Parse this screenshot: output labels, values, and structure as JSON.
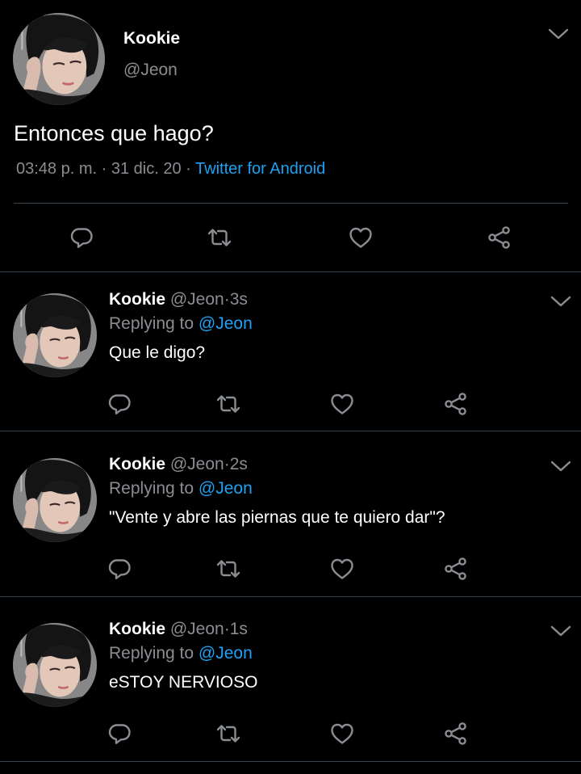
{
  "main_tweet": {
    "author_name": "Kookie",
    "author_handle": "@Jeon",
    "text": "Entonces que hago?",
    "time": "03:48 p. m.",
    "date": "31 dic. 20",
    "source": "Twitter for Android",
    "separator": "·"
  },
  "replies": [
    {
      "author_name": "Kookie",
      "author_handle": "@Jeon",
      "age": "3s",
      "replying_label": "Replying to",
      "replying_to": "@Jeon",
      "text": "Que le digo?"
    },
    {
      "author_name": "Kookie",
      "author_handle": "@Jeon",
      "age": "2s",
      "replying_label": "Replying to",
      "replying_to": "@Jeon",
      "text": "\"Vente y abre las piernas que te quiero dar\"?"
    },
    {
      "author_name": "Kookie",
      "author_handle": "@Jeon",
      "age": "1s",
      "replying_label": "Replying to",
      "replying_to": "@Jeon",
      "text": "eSTOY NERVIOSO"
    }
  ],
  "icons": {
    "reply": "reply-icon",
    "retweet": "retweet-icon",
    "like": "heart-icon",
    "share": "share-icon",
    "more": "chevron-down-icon"
  },
  "colors": {
    "background": "#000000",
    "text": "#ffffff",
    "secondary": "#8a8d91",
    "accent": "#1da1f2",
    "divider": "#38444d"
  }
}
